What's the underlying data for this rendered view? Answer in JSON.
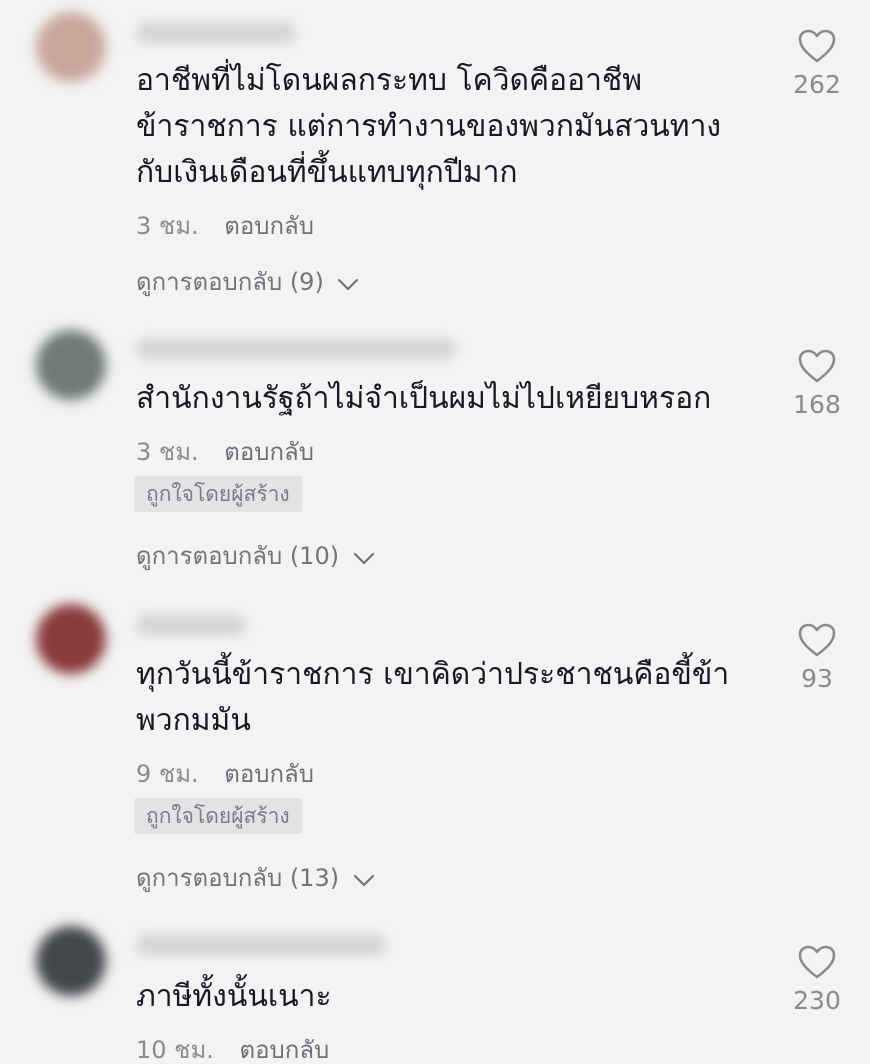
{
  "comments": [
    {
      "text": "อาชีพที่ไม่โดนผลกระทบ โควิดคืออาชีพ\nข้าราชการ แต่การทำงานของพวกมันสวนทาง\nกับเงินเดือนที่ขึ้นแทบทุกปีมาก",
      "time": "3 ชม.",
      "reply": "ตอบกลับ",
      "likes": "262",
      "view_replies": "ดูการตอบกลับ (9)",
      "avatar_color": "#c9a79b"
    },
    {
      "text": "สำนักงานรัฐถ้าไม่จำเป็นผมไม่ไปเหยียบหรอก",
      "time": "3 ชม.",
      "reply": "ตอบกลับ",
      "badge": "ถูกใจโดยผู้สร้าง",
      "likes": "168",
      "view_replies": "ดูการตอบกลับ (10)",
      "avatar_color": "#6f7a74"
    },
    {
      "text": "ทุกวันนี้ข้าราชการ เขาคิดว่าประชาชนคือขี้ข้า\nพวกมมัน",
      "time": "9 ชม.",
      "reply": "ตอบกลับ",
      "badge": "ถูกใจโดยผู้สร้าง",
      "likes": "93",
      "view_replies": "ดูการตอบกลับ (13)",
      "avatar_color": "#8a3b3b"
    },
    {
      "text": "ภาษีทั้งนั้นเนาะ",
      "time": "10 ชม.",
      "reply": "ตอบกลับ",
      "likes": "230",
      "avatar_color": "#44474c"
    }
  ]
}
